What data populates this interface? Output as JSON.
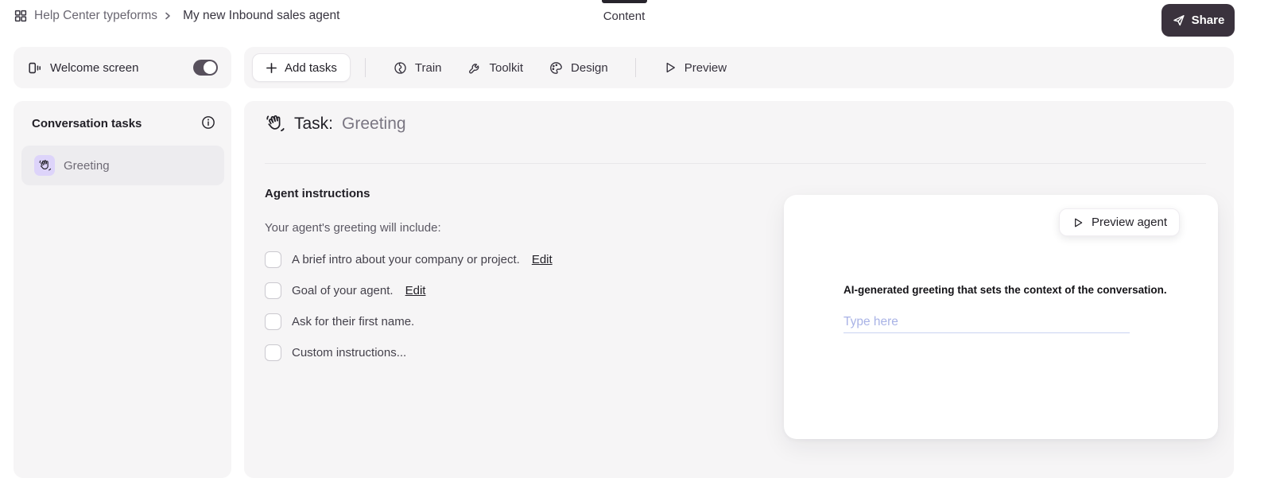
{
  "topbar": {
    "workspace_label": "Help Center typeforms",
    "form_title": "My new Inbound sales agent",
    "content_tab_label": "Content",
    "share_button_label": "Share"
  },
  "left_panel": {
    "welcome_screen_label": "Welcome screen",
    "welcome_screen_enabled": true,
    "conversation_tasks_title": "Conversation tasks",
    "tasks": [
      {
        "label": "Greeting",
        "icon": "wave-hand-icon",
        "selected": true
      }
    ]
  },
  "toolbar": {
    "add_tasks_label": "Add tasks",
    "items": [
      {
        "label": "Train",
        "icon": "brain-icon"
      },
      {
        "label": "Toolkit",
        "icon": "wrench-icon"
      },
      {
        "label": "Design",
        "icon": "palette-icon"
      }
    ],
    "preview_label": "Preview"
  },
  "main": {
    "task_header_prefix": "Task:",
    "task_header_name": "Greeting",
    "section_title": "Agent instructions",
    "instructions_intro": "Your agent's greeting will include:",
    "checklist": [
      {
        "label": "A brief intro about your company or project.",
        "edit_label": "Edit",
        "checked": false
      },
      {
        "label": "Goal of your agent.",
        "edit_label": "Edit",
        "checked": false
      },
      {
        "label": "Ask for their first name.",
        "checked": false
      },
      {
        "label": "Custom instructions...",
        "checked": false
      }
    ],
    "preview_card": {
      "preview_agent_button_label": "Preview agent",
      "greeting_description": "AI-generated greeting that sets the context of the conversation.",
      "input_placeholder": "Type here"
    }
  },
  "colors": {
    "share_button_bg": "#3a323d",
    "active_tab_indicator": "#27242c",
    "card_bg": "#f6f5f6",
    "selected_row_bg": "#edecef",
    "task_icon_bg": "#ddd4fa",
    "placeholder_text": "#a9b3e6",
    "input_underline": "#cad3f1"
  }
}
